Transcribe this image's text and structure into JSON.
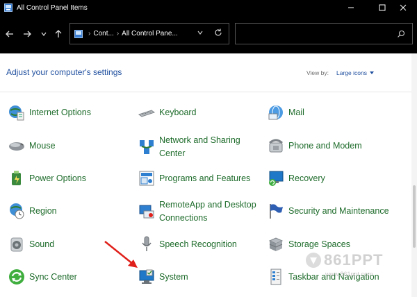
{
  "window": {
    "title": "All Control Panel Items",
    "controls": {
      "minimize": "—",
      "maximize": "☐",
      "close": "✕"
    }
  },
  "navigation": {
    "back_icon": "arrow-left-icon",
    "forward_icon": "arrow-right-icon",
    "history_icon": "chevron-down-icon",
    "up_icon": "arrow-up-icon",
    "breadcrumbs": [
      "Cont...",
      "All Control Pane..."
    ],
    "refresh_icon": "refresh-icon",
    "search_placeholder": ""
  },
  "header": {
    "title": "Adjust your computer's settings",
    "view_by_label": "View by:",
    "view_mode": "Large icons"
  },
  "items": [
    {
      "label": "Internet Options",
      "icon": "globe-document-icon"
    },
    {
      "label": "Keyboard",
      "icon": "keyboard-icon"
    },
    {
      "label": "Mail",
      "icon": "mail-icon"
    },
    {
      "label": "Mouse",
      "icon": "mouse-icon"
    },
    {
      "label": "Network and Sharing Center",
      "line1": "Network and Sharing",
      "line2": "Center",
      "icon": "network-icon"
    },
    {
      "label": "Phone and Modem",
      "icon": "phone-icon"
    },
    {
      "label": "Power Options",
      "icon": "power-icon"
    },
    {
      "label": "Programs and Features",
      "icon": "programs-icon"
    },
    {
      "label": "Recovery",
      "icon": "recovery-icon"
    },
    {
      "label": "Region",
      "icon": "globe-clock-icon"
    },
    {
      "label": "RemoteApp and Desktop Connections",
      "line1": "RemoteApp and Desktop",
      "line2": "Connections",
      "icon": "remoteapp-icon"
    },
    {
      "label": "Security and Maintenance",
      "icon": "flag-icon"
    },
    {
      "label": "Sound",
      "icon": "speaker-icon"
    },
    {
      "label": "Speech Recognition",
      "icon": "microphone-icon"
    },
    {
      "label": "Storage Spaces",
      "icon": "storage-icon"
    },
    {
      "label": "Sync Center",
      "icon": "sync-icon"
    },
    {
      "label": "System",
      "icon": "system-icon"
    },
    {
      "label": "Taskbar and Navigation",
      "icon": "taskbar-icon"
    }
  ],
  "watermark": {
    "text": "861PPT",
    "sub": "www.861ppt.com"
  },
  "colors": {
    "titlebar": "#000000",
    "link_green": "#1d6b2a",
    "heading_blue": "#1e4e9e",
    "annotation_red": "#e0201a"
  }
}
